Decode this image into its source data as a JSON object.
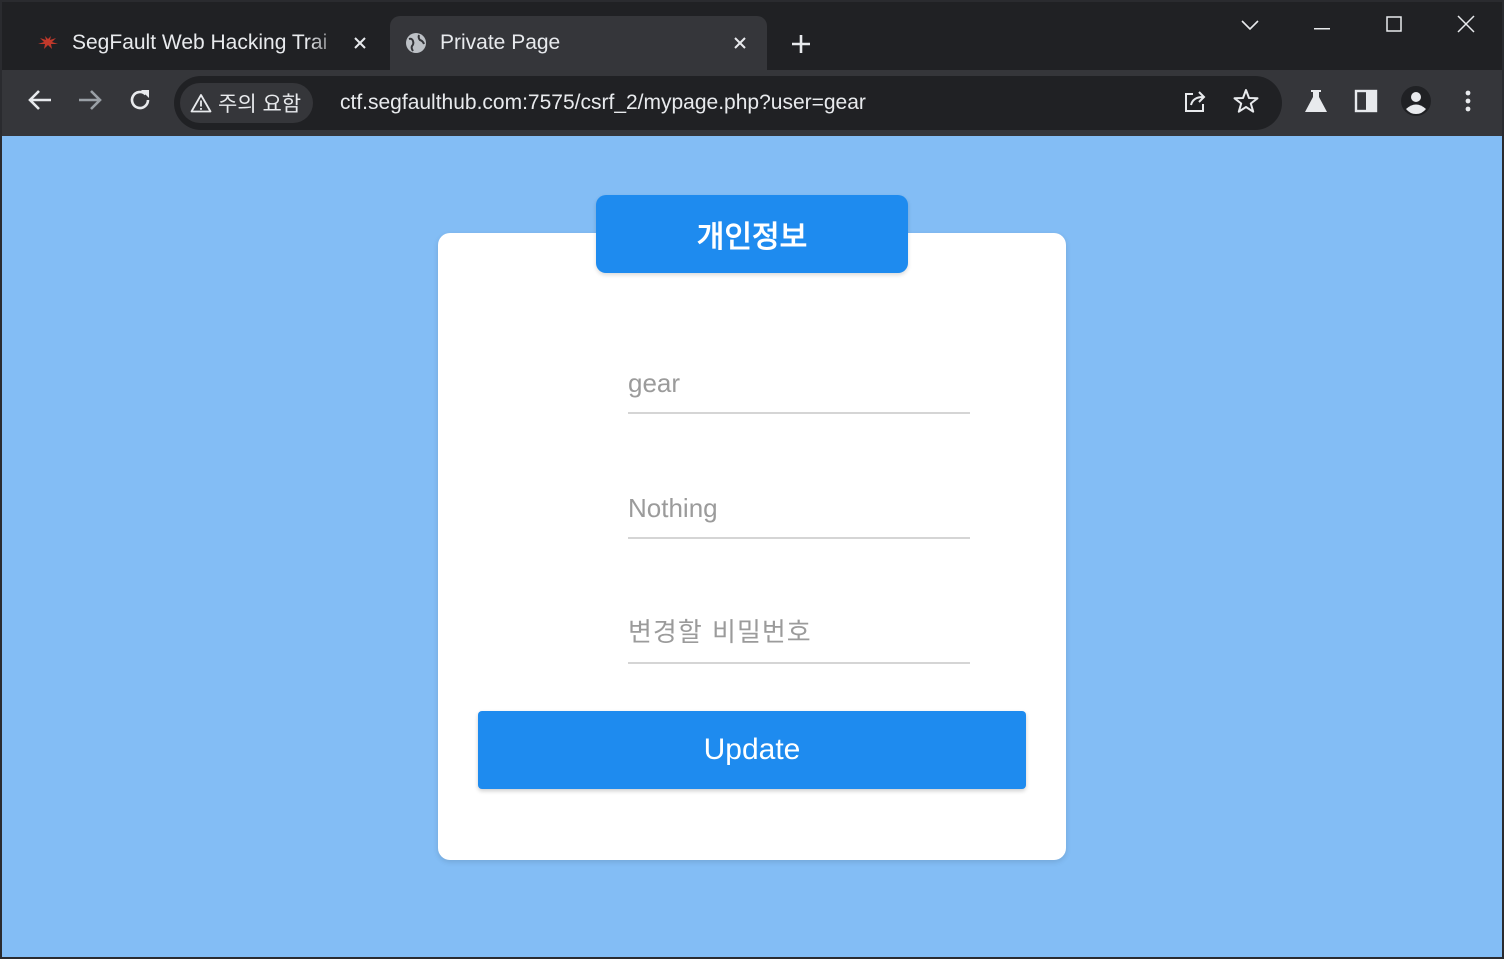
{
  "browser": {
    "tabs": [
      {
        "title": "SegFault Web Hacking Trai",
        "favicon": "segfault-logo-icon",
        "active": false
      },
      {
        "title": "Private Page",
        "favicon": "globe-icon",
        "active": true
      }
    ],
    "security_chip": "주의 요함",
    "url": "ctf.segfaulthub.com:7575/csrf_2/mypage.php?user=gear"
  },
  "page": {
    "header": "개인정보",
    "fields": {
      "username_placeholder": "gear",
      "info_placeholder": "Nothing",
      "password_placeholder": "변경할 비밀번호"
    },
    "update_label": "Update"
  },
  "colors": {
    "page_background": "#83bdf5",
    "accent": "#1e8bef",
    "card": "#ffffff"
  }
}
